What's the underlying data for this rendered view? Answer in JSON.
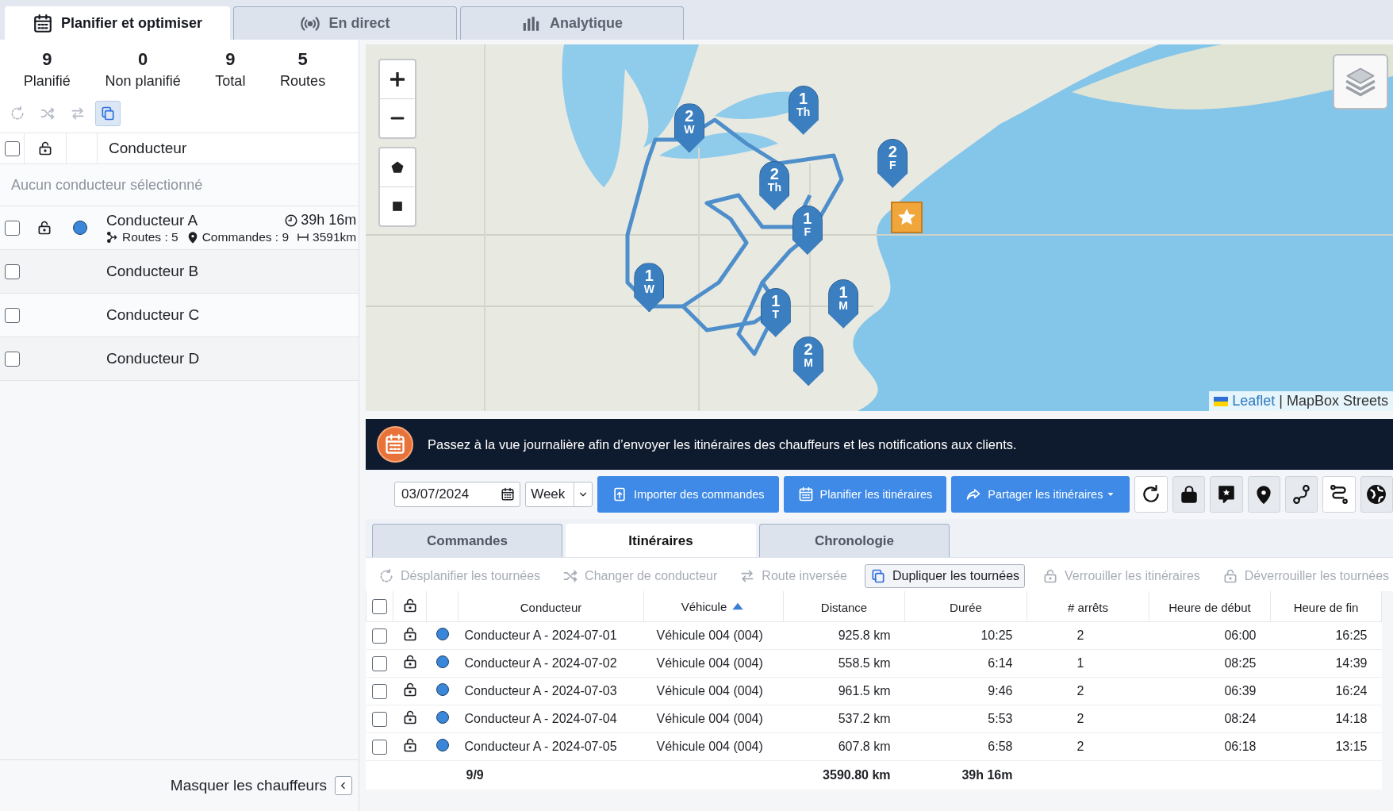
{
  "top_tabs": [
    {
      "kind": "plan",
      "label": "Planifier et optimiser",
      "selected": true
    },
    {
      "kind": "live",
      "label": "En direct",
      "selected": false
    },
    {
      "kind": "analytics",
      "label": "Analytique",
      "selected": false
    }
  ],
  "summary": [
    {
      "value": "9",
      "label": "Planifié"
    },
    {
      "value": "0",
      "label": "Non planifié"
    },
    {
      "value": "9",
      "label": "Total"
    },
    {
      "value": "5",
      "label": "Routes"
    }
  ],
  "driver_toolbar": [
    {
      "kind": "unplan",
      "disabled": true
    },
    {
      "kind": "change-driver",
      "disabled": true
    },
    {
      "kind": "reverse",
      "disabled": true
    },
    {
      "kind": "duplicate",
      "disabled": false
    }
  ],
  "driver_table": {
    "all_checked": false,
    "header": "Conducteur",
    "empty_message": "Aucun conducteur sélectionné",
    "drivers": [
      {
        "name": "Conducteur A",
        "checked": false,
        "color": "#3a86d8",
        "duration": "39h 16m",
        "routes": "Routes : 5",
        "orders": "Commandes : 9",
        "distance": "3591km"
      },
      {
        "name": "Conducteur B",
        "checked": false
      },
      {
        "name": "Conducteur C",
        "checked": false
      },
      {
        "name": "Conducteur D",
        "checked": false
      }
    ]
  },
  "hide_drivers": "Masquer les chauffeurs",
  "map": {
    "kind": "picture",
    "markers": [
      {
        "number": "2",
        "day": "W"
      },
      {
        "number": "1",
        "day": "Th"
      },
      {
        "number": "2",
        "day": "F"
      },
      {
        "number": "2",
        "day": "Th"
      },
      {
        "number": "1",
        "day": "F"
      },
      {
        "number": "1",
        "day": "W"
      },
      {
        "number": "1",
        "day": "T"
      },
      {
        "number": "1",
        "day": "M"
      },
      {
        "number": "2",
        "day": "M"
      }
    ],
    "attribution_link": "Leaflet",
    "attribution_separator": "|",
    "attribution": "MapBox Streets"
  },
  "banner": "Passez à la vue journalière afin d’envoyer les itinéraires des chauffeurs et les notifications aux clients.",
  "toolbar": {
    "date": "03/07/2024",
    "period": "Week",
    "buttons": [
      {
        "kind": "import",
        "label": "Importer des commandes"
      },
      {
        "kind": "plan",
        "label": "Planifier les itinéraires"
      },
      {
        "kind": "share",
        "label": "Partager les itinéraires"
      }
    ]
  },
  "tabs": [
    {
      "label": "Commandes",
      "selected": false
    },
    {
      "label": "Itinéraires",
      "selected": true
    },
    {
      "label": "Chronologie",
      "selected": false
    }
  ],
  "actions": [
    {
      "kind": "unplan",
      "label": "Désplanifier les tournées",
      "disabled": true
    },
    {
      "kind": "change-driver",
      "label": "Changer de conducteur",
      "disabled": true
    },
    {
      "kind": "reverse",
      "label": "Route inversée",
      "disabled": true
    },
    {
      "kind": "duplicate",
      "label": "Dupliquer les tournées",
      "disabled": false
    },
    {
      "kind": "lock",
      "label": "Verrouiller les itinéraires",
      "disabled": true
    },
    {
      "kind": "unlock",
      "label": "Déverrouiller  les tournées",
      "disabled": true
    }
  ],
  "table": {
    "all_checked": false,
    "columns": [
      {
        "label": "Conducteur",
        "sorted": false
      },
      {
        "label": "Véhicule",
        "sorted": true
      },
      {
        "label": "Distance",
        "sorted": false
      },
      {
        "label": "Durée",
        "sorted": false
      },
      {
        "label": "# arrêts",
        "sorted": false
      },
      {
        "label": "Heure de début",
        "sorted": false
      },
      {
        "label": "Heure de fin",
        "sorted": false
      }
    ],
    "rows": [
      {
        "checked": false,
        "color": "#3a86d8",
        "cells": [
          "Conducteur A - 2024-07-01",
          "Véhicule 004 (004)",
          "925.8 km",
          "10:25",
          "2",
          "06:00",
          "16:25"
        ]
      },
      {
        "checked": false,
        "color": "#3a86d8",
        "cells": [
          "Conducteur A - 2024-07-02",
          "Véhicule 004 (004)",
          "558.5 km",
          "6:14",
          "1",
          "08:25",
          "14:39"
        ]
      },
      {
        "checked": false,
        "color": "#3a86d8",
        "cells": [
          "Conducteur A - 2024-07-03",
          "Véhicule 004 (004)",
          "961.5 km",
          "9:46",
          "2",
          "06:39",
          "16:24"
        ]
      },
      {
        "checked": false,
        "color": "#3a86d8",
        "cells": [
          "Conducteur A - 2024-07-04",
          "Véhicule 004 (004)",
          "537.2 km",
          "5:53",
          "2",
          "08:24",
          "14:18"
        ]
      },
      {
        "checked": false,
        "color": "#3a86d8",
        "cells": [
          "Conducteur A - 2024-07-05",
          "Véhicule 004 (004)",
          "607.8 km",
          "6:58",
          "2",
          "06:18",
          "13:15"
        ]
      }
    ],
    "totals": {
      "count": "9/9",
      "distance": "3590.80 km",
      "duration": "39h 16m"
    }
  }
}
